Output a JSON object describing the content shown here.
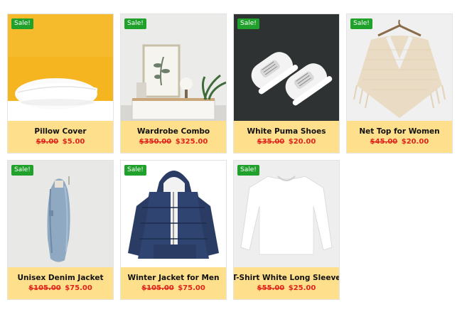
{
  "products": [
    {
      "name": "Pillow Cover",
      "old_price": "$9.00",
      "new_price": "$5.00",
      "badge": "Sale!",
      "image": "pillow-photo"
    },
    {
      "name": "Wardrobe Combo",
      "old_price": "$350.00",
      "new_price": "$325.00",
      "badge": "Sale!",
      "image": "wardrobe-photo"
    },
    {
      "name": "White Puma Shoes",
      "old_price": "$35.00",
      "new_price": "$20.00",
      "badge": "Sale!",
      "image": "shoes-photo"
    },
    {
      "name": "Net Top for Women",
      "old_price": "$45.00",
      "new_price": "$20.00",
      "badge": "Sale!",
      "image": "net-top-photo"
    },
    {
      "name": "Unisex Denim Jacket",
      "old_price": "$105.00",
      "new_price": "$75.00",
      "badge": "Sale!",
      "image": "denim-jacket-photo"
    },
    {
      "name": "Winter Jacket for Men",
      "old_price": "$105.00",
      "new_price": "$75.00",
      "badge": "Sale!",
      "image": "winter-jacket-photo"
    },
    {
      "name": "T-Shirt White Long Sleeve",
      "old_price": "$55.00",
      "new_price": "$25.00",
      "badge": "Sale!",
      "image": "tshirt-photo"
    }
  ],
  "colors": {
    "price_panel": "#fee08c",
    "sale_badge": "#1fa12c",
    "price_text": "#e0241b"
  }
}
